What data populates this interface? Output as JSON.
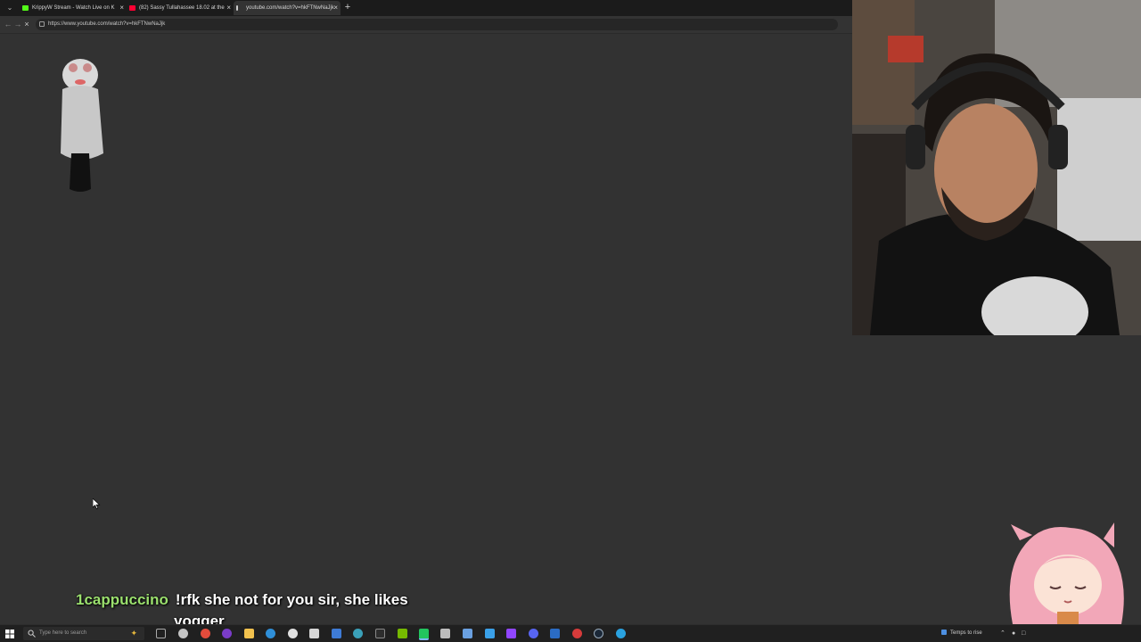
{
  "browser": {
    "tabs": [
      {
        "title": "KrippyW Stream - Watch Live on K",
        "favicon_color": "#53fc18",
        "active": false
      },
      {
        "title": "(82) Sassy Tullahassee 18.02 at the",
        "favicon_color": "#ff0033",
        "active": false
      },
      {
        "title": "youtube.com/watch?v=hkFTNwNaJjk",
        "favicon_color": "#cccccc",
        "active": true
      }
    ],
    "url": "https://www.youtube.com/watch?v=hkFTNwNaJjk",
    "icons": {
      "tab_menu": "chevron-down-icon",
      "new_tab": "plus-icon",
      "back": "back-arrow-icon",
      "forward": "forward-arrow-icon",
      "reload": "stop-loading-icon",
      "tab_close": "close-icon"
    }
  },
  "chat": {
    "username": "1cappuccino",
    "message_line1": "!rfk she not for you sir, she likes",
    "message_line2": "yogger",
    "username_color": "#9be06e"
  },
  "taskbar": {
    "search_placeholder": "Type here to search",
    "weather_text": "Temps to rise",
    "pinned_icons": [
      "task-view-icon",
      "widgets-icon",
      "chrome-icon",
      "obs-icon",
      "file-explorer-icon",
      "edge-icon",
      "clock-icon",
      "terminal-icon",
      "photos-icon",
      "notepad-icon",
      "mail-icon",
      "app-icon",
      "nvidia-icon",
      "phone-icon",
      "settings-icon",
      "twitch-icon",
      "discord-icon",
      "word-icon",
      "opera-icon",
      "steam-icon",
      "browser-icon"
    ]
  },
  "colors": {
    "page_background": "#323232",
    "tabstrip": "#1b1b1b",
    "taskbar": "#202020"
  }
}
